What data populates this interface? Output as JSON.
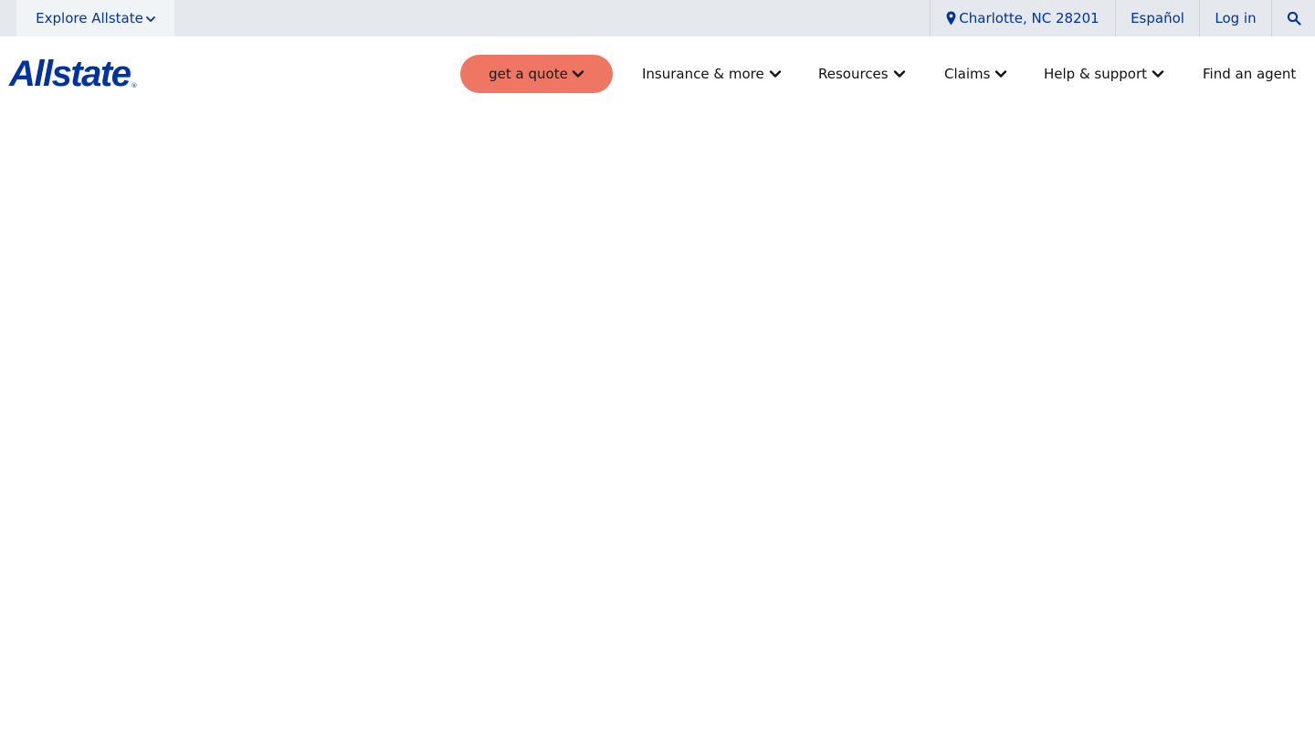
{
  "utility_bar": {
    "explore_label": "Explore Allstate",
    "location_label": "Charlotte, NC 28201",
    "language_label": "Español",
    "login_label": "Log in"
  },
  "header": {
    "logo_text": "Allstate",
    "logo_mark": "®",
    "quote_label": "get a quote",
    "nav": {
      "insurance": "Insurance & more",
      "resources": "Resources",
      "claims": "Claims",
      "help": "Help & support",
      "agent": "Find an agent"
    }
  },
  "icons": {
    "explore": "chevron-down-icon",
    "location": "map-pin-icon",
    "search": "search-icon",
    "dropdown": "chevron-down-icon"
  },
  "colors": {
    "brand_blue": "#0033a0",
    "quote_coral": "#ee7663",
    "utility_bg": "#e5e9ee",
    "nav_text": "#111111"
  }
}
